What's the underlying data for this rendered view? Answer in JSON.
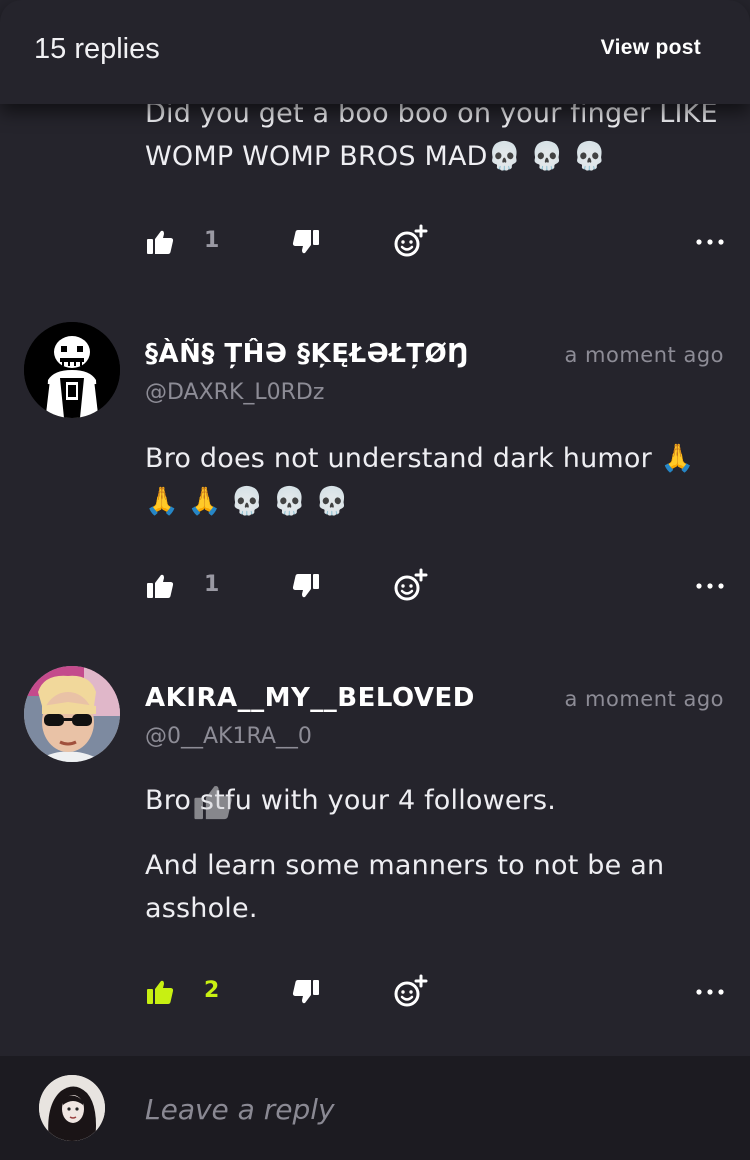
{
  "header": {
    "title": "15 replies",
    "view_post_label": "View post"
  },
  "comments": [
    {
      "text": [
        "Did you get a boo boo on your finger LIKE WOMP WOMP BROS MAD💀 💀 💀"
      ],
      "likes": "1",
      "liked": false
    },
    {
      "author": "§ÀÑ§ ȚĤƏ §ĶĘŁƏŁȚØŊ",
      "handle": "@DAXRK_L0RDz",
      "time": "a moment ago",
      "text": [
        "Bro does not understand dark humor 🙏 🙏 🙏 💀 💀 💀"
      ],
      "likes": "1",
      "liked": false
    },
    {
      "author": "AKIRA__MY__BELOVED",
      "handle": "@0__AK1RA__0",
      "time": "a moment ago",
      "text": [
        "Bro stfu with your 4 followers.",
        "And learn some manners to not be an asshole."
      ],
      "likes": "2",
      "liked": true
    }
  ],
  "reply": {
    "placeholder": "Leave a reply"
  },
  "colors": {
    "background": "#25242c",
    "accent": "#c8f012",
    "muted": "#8d8c96",
    "reply_bar": "#1c1b21"
  },
  "icons": [
    "thumbs-up-icon",
    "thumbs-down-icon",
    "add-reaction-icon",
    "more-icon"
  ]
}
